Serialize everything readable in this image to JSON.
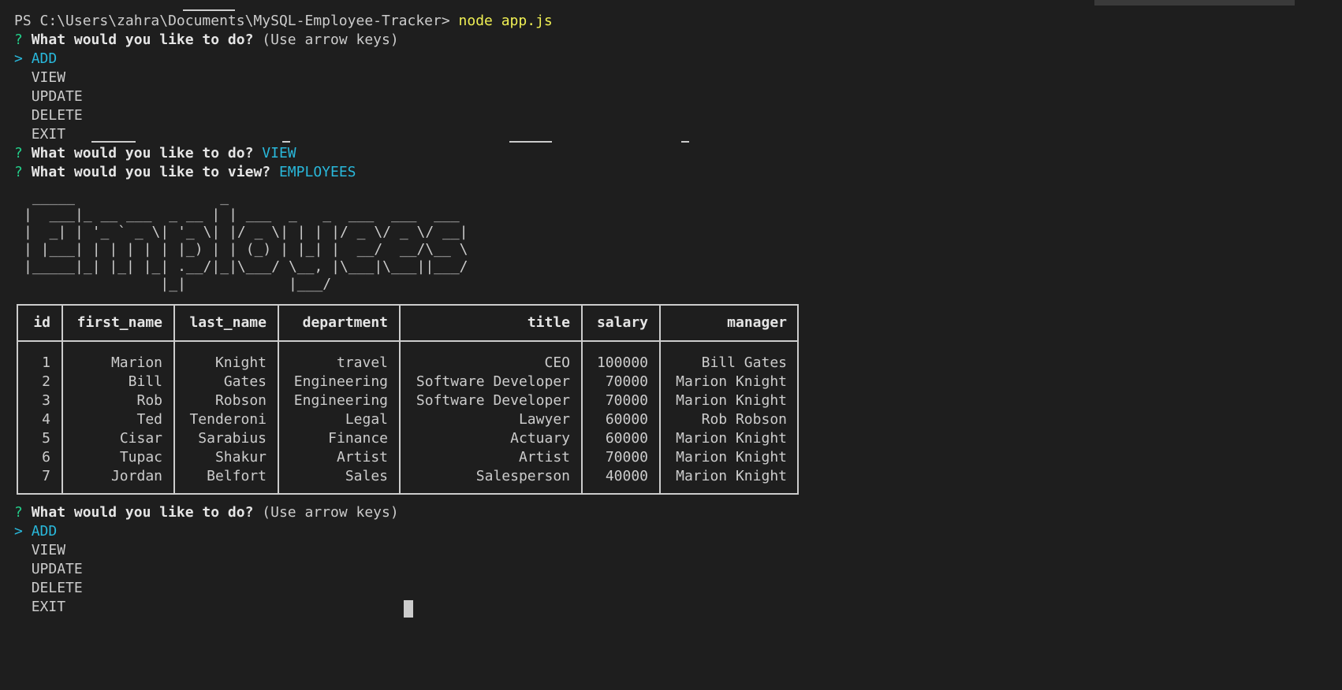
{
  "prompt": {
    "path": "PS C:\\Users\\zahra\\Documents\\MySQL-Employee-Tracker>",
    "command": "node app.js"
  },
  "menu1": {
    "mark": "?",
    "question": "What would you like to do?",
    "hint": "(Use arrow keys)",
    "pointer": ">",
    "options": [
      "ADD",
      "VIEW",
      "UPDATE",
      "DELETE",
      "EXIT"
    ]
  },
  "answer1": {
    "mark": "?",
    "question": "What would you like to do?",
    "answer": "VIEW"
  },
  "answer2": {
    "mark": "?",
    "question": "What would you like to view?",
    "answer": "EMPLOYEES"
  },
  "banner": {
    "text": "Employees",
    "ascii": " _____                 _\n|  ___|_ __ ___  _ __ | | ___  _   _  ___  ___  ___\n|  _| | '_ ` _ \\| '_ \\| |/ _ \\| | | |/ _ \\/ _ \\/ __|\n| |___| | | | | | |_) | | (_) | |_| |  __/  __/\\__ \\\n|_____|_| |_| |_| .__/|_|\\___/ \\__, |\\___|\\___||___/\n                |_|            |___/"
  },
  "table": {
    "columns": [
      "id",
      "first_name",
      "last_name",
      "department",
      "title",
      "salary",
      "manager"
    ],
    "rows": [
      [
        "1",
        "Marion",
        "Knight",
        "travel",
        "CEO",
        "100000",
        "Bill Gates"
      ],
      [
        "2",
        "Bill",
        "Gates",
        "Engineering",
        "Software Developer",
        "70000",
        "Marion Knight"
      ],
      [
        "3",
        "Rob",
        "Robson",
        "Engineering",
        "Software Developer",
        "70000",
        "Marion Knight"
      ],
      [
        "4",
        "Ted",
        "Tenderoni",
        "Legal",
        "Lawyer",
        "60000",
        "Rob Robson"
      ],
      [
        "5",
        "Cisar",
        "Sarabius",
        "Finance",
        "Actuary",
        "60000",
        "Marion Knight"
      ],
      [
        "6",
        "Tupac",
        "Shakur",
        "Artist",
        "Artist",
        "70000",
        "Marion Knight"
      ],
      [
        "7",
        "Jordan",
        "Belfort",
        "Sales",
        "Salesperson",
        "40000",
        "Marion Knight"
      ]
    ]
  },
  "menu2": {
    "mark": "?",
    "question": "What would you like to do?",
    "hint": "(Use arrow keys)",
    "pointer": ">",
    "options": [
      "ADD",
      "VIEW",
      "UPDATE",
      "DELETE",
      "EXIT"
    ]
  },
  "colors": {
    "background": "#1e1e1e",
    "text": "#cccccc",
    "command": "#f0f054",
    "question_mark": "#23d18b",
    "highlight": "#29b8db"
  }
}
